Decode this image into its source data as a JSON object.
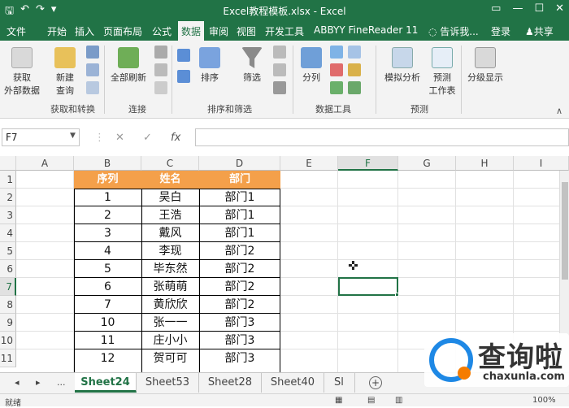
{
  "window": {
    "title": "Excel教程模板.xlsx - Excel",
    "controls": [
      "▭",
      "—",
      "☐",
      "✕"
    ]
  },
  "qat": {
    "save": "🖫",
    "undo": "↶",
    "redo": "↷",
    "more": "▾"
  },
  "menu_tabs": [
    "文件",
    "开始",
    "插入",
    "页面布局",
    "公式",
    "数据",
    "审阅",
    "视图",
    "开发工具",
    "ABBYY FineReader 11"
  ],
  "active_tab": "数据",
  "tell_me": "告诉我...",
  "login": "登录",
  "share": "共享",
  "ribbon": {
    "get_external": "获取\n外部数据",
    "new_query": "新建\n查询",
    "group1": "获取和转换",
    "refresh_all": "全部刷新",
    "group2": "连接",
    "sort": "排序",
    "filter": "筛选",
    "group3": "排序和筛选",
    "text_to_columns": "分列",
    "group4": "数据工具",
    "what_if": "模拟分析",
    "forecast": "预测\n工作表",
    "group5": "预测",
    "outline": "分级显示"
  },
  "formula_bar": {
    "name_box": "F7",
    "cancel": "✕",
    "enter": "✓",
    "fx": "fx",
    "value": ""
  },
  "columns": [
    "A",
    "B",
    "C",
    "D",
    "E",
    "F",
    "G",
    "H",
    "I"
  ],
  "selected_col": "F",
  "rows": [
    "1",
    "2",
    "3",
    "4",
    "5",
    "6",
    "7",
    "8",
    "9",
    "10",
    "11"
  ],
  "selected_row": "7",
  "table": {
    "headers": [
      "序列",
      "姓名",
      "部门"
    ],
    "rows": [
      [
        "1",
        "吴白",
        "部门1"
      ],
      [
        "2",
        "王浩",
        "部门1"
      ],
      [
        "3",
        "戴风",
        "部门1"
      ],
      [
        "4",
        "李现",
        "部门2"
      ],
      [
        "5",
        "毕东然",
        "部门2"
      ],
      [
        "6",
        "张萌萌",
        "部门2"
      ],
      [
        "7",
        "黄欣欣",
        "部门2"
      ],
      [
        "10",
        "张一一",
        "部门3"
      ],
      [
        "11",
        "庄小小",
        "部门3"
      ],
      [
        "12",
        "贺可可",
        "部门3"
      ]
    ]
  },
  "sheets": [
    "Sheet24",
    "Sheet53",
    "Sheet28",
    "Sheet40",
    "Sl"
  ],
  "active_sheet": "Sheet24",
  "sheet_nav": [
    "◂",
    "▸",
    "..."
  ],
  "status": {
    "ready": "就绪",
    "zoom": "100%"
  },
  "watermark": {
    "text": "查询啦",
    "sub": "chaxunla.com"
  },
  "colors": {
    "excel_green": "#217346",
    "header_orange": "#f4a04a"
  }
}
